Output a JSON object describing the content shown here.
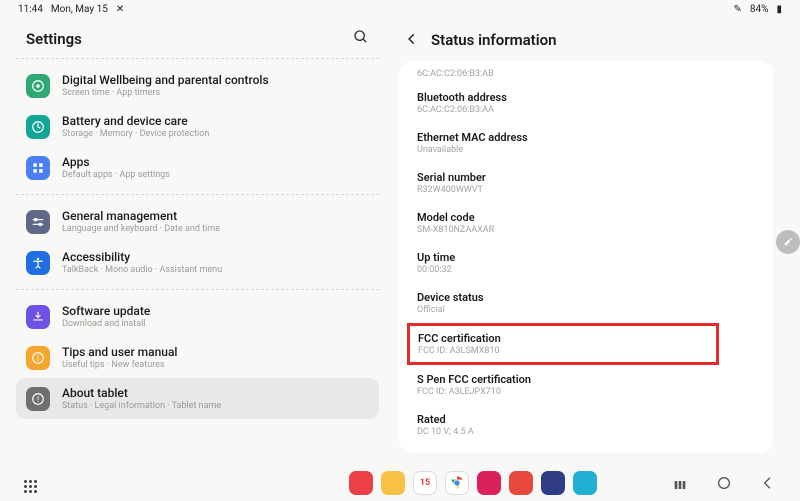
{
  "statusbar": {
    "time": "11:44",
    "date": "Mon, May 15",
    "airplane_icon": "✕",
    "battery_pct": "84%"
  },
  "left": {
    "title": "Settings",
    "groups": [
      [
        {
          "icon": "wellbeing",
          "color": "#2fa876",
          "title": "Digital Wellbeing and parental controls",
          "sub": "Screen time  ·  App timers"
        },
        {
          "icon": "battery",
          "color": "#15a597",
          "title": "Battery and device care",
          "sub": "Storage  ·  Memory  ·  Device protection"
        },
        {
          "icon": "apps",
          "color": "#4d7ff2",
          "title": "Apps",
          "sub": "Default apps  ·  App settings"
        }
      ],
      [
        {
          "icon": "general",
          "color": "#5f6888",
          "title": "General management",
          "sub": "Language and keyboard  ·  Date and time"
        },
        {
          "icon": "accessibility",
          "color": "#1f6fe0",
          "title": "Accessibility",
          "sub": "TalkBack  ·  Mono audio  ·  Assistant menu"
        }
      ],
      [
        {
          "icon": "update",
          "color": "#6e52e8",
          "title": "Software update",
          "sub": "Download and install"
        },
        {
          "icon": "tips",
          "color": "#f3a72e",
          "title": "Tips and user manual",
          "sub": "Useful tips  ·  New features"
        },
        {
          "icon": "about",
          "color": "#6f6f6f",
          "title": "About tablet",
          "sub": "Status  ·  Legal information  ·  Tablet name",
          "selected": true
        }
      ]
    ]
  },
  "right": {
    "title": "Status information",
    "top_partial": "6C:AC:C2:06:B3:AB",
    "items": [
      {
        "k": "Bluetooth address",
        "v": "6C:AC:C2:06:B3:AA"
      },
      {
        "k": "Ethernet MAC address",
        "v": "Unavailable"
      },
      {
        "k": "Serial number",
        "v": "R32W400WWVT"
      },
      {
        "k": "Model code",
        "v": "SM-X810NZAAXAR"
      },
      {
        "k": "Up time",
        "v": "00:00:32"
      },
      {
        "k": "Device status",
        "v": "Official"
      },
      {
        "k": "FCC certification",
        "v": "FCC ID: A3LSMX810",
        "highlight": true
      },
      {
        "k": "S Pen FCC certification",
        "v": "FCC ID: A3LEJPX710"
      },
      {
        "k": "Rated",
        "v": "DC 10 V; 4.5 A"
      }
    ]
  },
  "taskbar": {
    "apps": [
      {
        "name": "app-1",
        "bg": "#ec3f48"
      },
      {
        "name": "app-files",
        "bg": "#f7c244"
      },
      {
        "name": "app-calendar",
        "bg": "#ffffff",
        "border": "#ddd",
        "label": "15"
      },
      {
        "name": "app-chrome",
        "bg": "#ffffff",
        "border": "#ddd"
      },
      {
        "name": "app-5",
        "bg": "#d9215b"
      },
      {
        "name": "app-6",
        "bg": "#e8473e"
      },
      {
        "name": "app-7",
        "bg": "#2e3d86"
      },
      {
        "name": "app-8",
        "bg": "#21b0d3"
      }
    ]
  }
}
